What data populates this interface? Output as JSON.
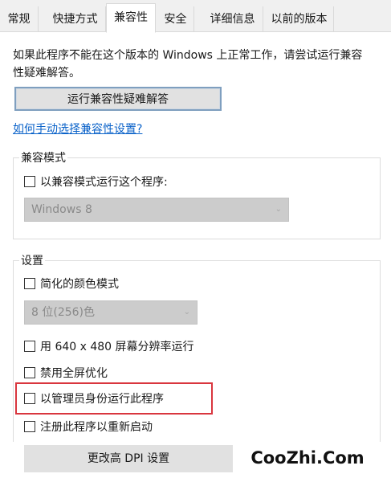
{
  "tabs": [
    {
      "label": "常规",
      "active": false
    },
    {
      "label": "快捷方式",
      "active": false
    },
    {
      "label": "兼容性",
      "active": true
    },
    {
      "label": "安全",
      "active": false
    },
    {
      "label": "详细信息",
      "active": false
    },
    {
      "label": "以前的版本",
      "active": false
    }
  ],
  "intro": {
    "line1": "如果此程序不能在这个版本的 Windows 上正常工作，请尝试运行兼容",
    "line2": "性疑难解答。"
  },
  "troubleshoot_button": "运行兼容性疑难解答",
  "manual_link": "如何手动选择兼容性设置?",
  "compat_mode": {
    "title": "兼容模式",
    "checkbox_label": "以兼容模式运行这个程序:",
    "checked": false,
    "select_value": "Windows 8",
    "select_disabled": true
  },
  "settings": {
    "title": "设置",
    "reduced_color": {
      "label": "简化的颜色模式",
      "checked": false
    },
    "color_select_value": "8 位(256)色",
    "res_640": {
      "label": "用 640 x 480 屏幕分辨率运行",
      "checked": false
    },
    "disable_fullscreen": {
      "label": "禁用全屏优化",
      "checked": false
    },
    "run_as_admin": {
      "label": "以管理员身份运行此程序",
      "checked": false
    },
    "register_restart": {
      "label": "注册此程序以重新启动",
      "checked": false
    },
    "dpi_button": "更改高 DPI 设置"
  },
  "watermark": "CooZhi.Com",
  "colors": {
    "highlight": "#d9363e",
    "link": "#0a62c9"
  }
}
